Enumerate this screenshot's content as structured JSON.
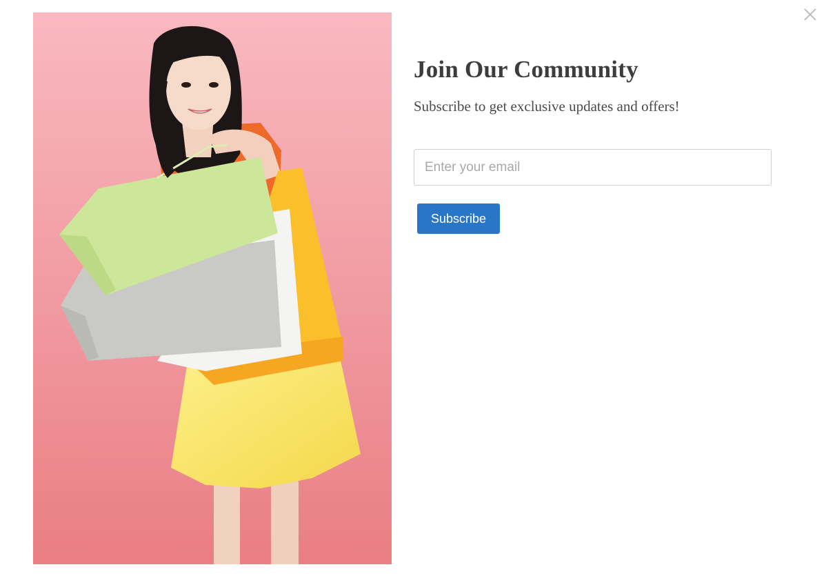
{
  "modal": {
    "title": "Join Our Community",
    "subtitle": "Subscribe to get exclusive updates and offers!",
    "email": {
      "value": "",
      "placeholder": "Enter your email"
    },
    "subscribe_label": "Subscribe",
    "close_icon": "close-icon"
  },
  "photo": {
    "subject": "woman-with-shopping-bags"
  },
  "colors": {
    "button": "#2a76c6",
    "title": "#3d3d3d",
    "photo_background": "#f2a4ad"
  }
}
